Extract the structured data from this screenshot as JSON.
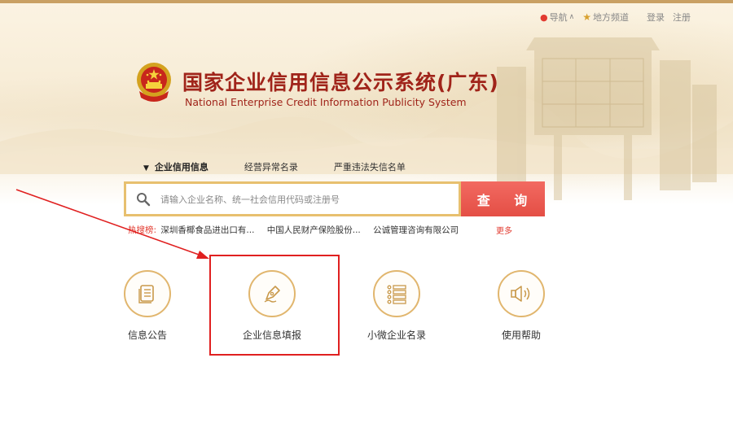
{
  "topnav": {
    "nav_label": "导航",
    "local_label": "地方频道",
    "login_label": "登录",
    "register_label": "注册"
  },
  "header": {
    "title_cn": "国家企业信用信息公示系统(广东)",
    "title_en": "National Enterprise Credit Information Publicity System"
  },
  "search": {
    "tabs": [
      {
        "label": "企业信用信息",
        "active": true
      },
      {
        "label": "经营异常名录",
        "active": false
      },
      {
        "label": "严重违法失信名单",
        "active": false
      }
    ],
    "placeholder": "请输入企业名称、统一社会信用代码或注册号",
    "button_label": "查 询"
  },
  "hot": {
    "label": "热搜榜:",
    "items": [
      "深圳香椰食品进出口有...",
      "中国人民财产保险股份...",
      "公诚管理咨询有限公司"
    ],
    "more_label": "更多"
  },
  "features": [
    {
      "label": "信息公告",
      "icon": "document-icon"
    },
    {
      "label": "企业信息填报",
      "icon": "pen-icon"
    },
    {
      "label": "小微企业名录",
      "icon": "list-icon"
    },
    {
      "label": "使用帮助",
      "icon": "speaker-icon"
    }
  ],
  "colors": {
    "brand_red": "#a0241a",
    "accent_gold": "#e1b66e",
    "search_button": "#e44e45",
    "annotation_red": "#e02020"
  }
}
